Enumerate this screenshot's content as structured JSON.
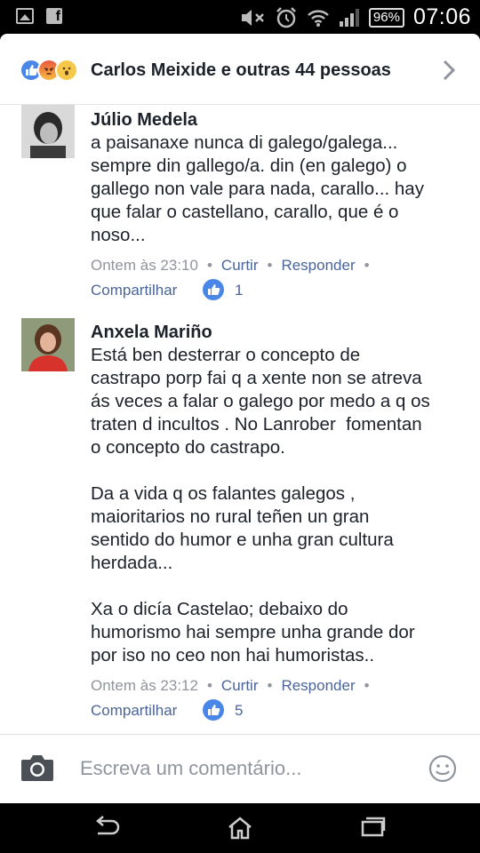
{
  "status_bar": {
    "battery": "96%",
    "time": "07:06",
    "icons": [
      "gallery-icon",
      "facebook-icon",
      "mute-icon",
      "alarm-icon",
      "wifi-icon",
      "signal-icon"
    ]
  },
  "reactions": {
    "icons": [
      "like-reaction-icon",
      "angry-reaction-icon",
      "wow-reaction-icon"
    ],
    "text": "Carlos Meixide e outras 44 pessoas"
  },
  "comments": [
    {
      "author": "Júlio Medela",
      "text": "a paisanaxe nunca di galego/galega...\nsempre din gallego/a. din (en galego) o\ngallego non vale para nada, carallo... hay\nque falar o castellano, carallo, que é o\nnoso...",
      "time": "Ontem às 23:10",
      "like_label": "Curtir",
      "reply_label": "Responder",
      "share_label": "Compartilhar",
      "likes": "1"
    },
    {
      "author": "Anxela Mariño",
      "text": "Está ben desterrar o concepto de\ncastrapo porp fai q a xente non se atreva\nás veces a falar o galego por medo a q os\ntraten d incultos . No Lanrober  fomentan\no concepto do castrapo.\n\nDa a vida q os falantes galegos ,\nmaioritarios no rural teñen un gran\nsentido do humor e unha gran cultura\nherdada...\n\nXa o dicía Castelao; debaixo do\nhumorismo hai sempre unha grande dor\npor iso no ceo non hai humoristas..",
      "time": "Ontem às 23:12",
      "like_label": "Curtir",
      "reply_label": "Responder",
      "share_label": "Compartilhar",
      "likes": "5"
    }
  ],
  "composer": {
    "placeholder": "Escreva um comentário..."
  },
  "colors": {
    "link": "#4b6598",
    "meta": "#90949c",
    "like_blue": "#4a86e8",
    "text": "#1d2129"
  }
}
